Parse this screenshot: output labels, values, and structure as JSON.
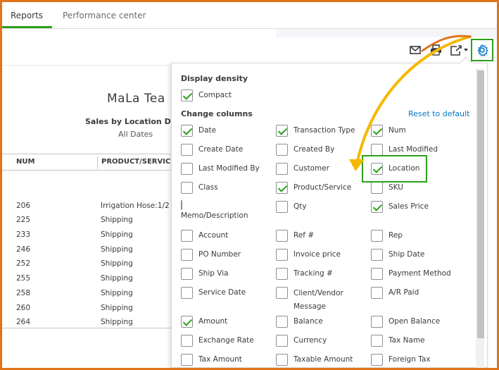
{
  "tabs": [
    {
      "label": "Reports",
      "active": true
    },
    {
      "label": "Performance center",
      "active": false
    }
  ],
  "toolbar": {
    "icons": [
      "email-icon",
      "print-icon",
      "export-icon",
      "gear-icon"
    ]
  },
  "report": {
    "company": "MaLa Tea",
    "title": "Sales by Location De",
    "dates": "All Dates",
    "columns": [
      "NUM",
      "PRODUCT/SERVICE"
    ],
    "rows": [
      {
        "num": "206",
        "product": "Irrigation Hose:1/2"
      },
      {
        "num": "225",
        "product": "Shipping"
      },
      {
        "num": "233",
        "product": "Shipping"
      },
      {
        "num": "246",
        "product": "Shipping"
      },
      {
        "num": "252",
        "product": "Shipping"
      },
      {
        "num": "255",
        "product": "Shipping"
      },
      {
        "num": "258",
        "product": "Shipping"
      },
      {
        "num": "260",
        "product": "Shipping"
      },
      {
        "num": "264",
        "product": "Shipping"
      }
    ]
  },
  "panel": {
    "display_density_label": "Display density",
    "compact": {
      "label": "Compact",
      "checked": true
    },
    "change_columns_label": "Change columns",
    "reset_label": "Reset to default",
    "columns": [
      {
        "label": "Date",
        "checked": true
      },
      {
        "label": "Transaction Type",
        "checked": true
      },
      {
        "label": "Num",
        "checked": true
      },
      {
        "label": "Create Date",
        "checked": false
      },
      {
        "label": "Created By",
        "checked": false
      },
      {
        "label": "Last Modified",
        "checked": false
      },
      {
        "label": "Last Modified By",
        "checked": false
      },
      {
        "label": "Customer",
        "checked": false
      },
      {
        "label": "Location",
        "checked": true
      },
      {
        "label": "Class",
        "checked": false
      },
      {
        "label": "Product/Service",
        "checked": true
      },
      {
        "label": "SKU",
        "checked": false
      },
      {
        "label": "Memo/Description",
        "checked": false
      },
      {
        "label": "Qty",
        "checked": false
      },
      {
        "label": "Sales Price",
        "checked": true
      },
      {
        "label": "Account",
        "checked": false
      },
      {
        "label": "Ref #",
        "checked": false
      },
      {
        "label": "Rep",
        "checked": false
      },
      {
        "label": "PO Number",
        "checked": false
      },
      {
        "label": "Invoice price",
        "checked": false
      },
      {
        "label": "Ship Date",
        "checked": false
      },
      {
        "label": "Ship Via",
        "checked": false
      },
      {
        "label": "Tracking #",
        "checked": false
      },
      {
        "label": "Payment Method",
        "checked": false
      },
      {
        "label": "Service Date",
        "checked": false
      },
      {
        "label": "Client/Vendor Message",
        "checked": false
      },
      {
        "label": "A/R Paid",
        "checked": false
      },
      {
        "label": "Amount",
        "checked": true
      },
      {
        "label": "Balance",
        "checked": false
      },
      {
        "label": "Open Balance",
        "checked": false
      },
      {
        "label": "Exchange Rate",
        "checked": false
      },
      {
        "label": "Currency",
        "checked": false
      },
      {
        "label": "Tax Name",
        "checked": false
      },
      {
        "label": "Tax Amount",
        "checked": false
      },
      {
        "label": "Taxable Amount",
        "checked": false
      },
      {
        "label": "Foreign Tax",
        "checked": false
      }
    ]
  },
  "colors": {
    "accent_green": "#2ca01c",
    "link_blue": "#0077c5",
    "frame_orange": "#e0731a",
    "arrow_yellow": "#f5b800"
  }
}
